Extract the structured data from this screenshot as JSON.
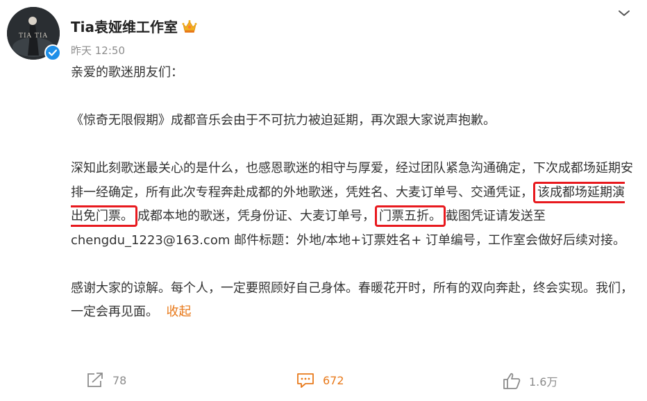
{
  "post": {
    "author": "Tia袁娅维工作室",
    "timestamp": "昨天 12:50",
    "avatar_text": "TIA TIA",
    "greeting": "亲爱的歌迷朋友们：",
    "para1": "《惊奇无限假期》成都音乐会由于不可抗力被迫延期，再次跟大家说声抱歉。",
    "para2_a": "深知此刻歌迷最关心的是什么，也感恩歌迷的相守与厚爱，经过团队紧急沟通确定，下次成都场延期安排一经确定，所有此次专程奔赴成都的外地歌迷，凭姓名、大麦订单号、交通凭证，",
    "para2_h1": "该成都场延期演出免门票。",
    "para2_b": "成都本地的歌迷，凭身份证、大麦订单号，",
    "para2_h2": "门票五折。",
    "para2_c": "截图凭证请发送至chengdu_1223@163.com 邮件标题：外地/本地+订票姓名+ 订单编号，工作室会做好后续对接。",
    "para3": "感谢大家的谅解。每个人，一定要照顾好自己身体。春暖花开时，所有的双向奔赴，终会实现。我们，一定会再见面。",
    "collapse_label": "收起"
  },
  "actions": {
    "share_count": "78",
    "comment_count": "672",
    "like_count": "1.6万"
  },
  "colors": {
    "highlight_border": "#e8191e",
    "accent": "#e8791a",
    "verified": "#1e8fe8"
  },
  "icons": [
    "verified-icon",
    "crown-icon",
    "more-chevron-icon",
    "share-icon",
    "comment-icon",
    "like-icon"
  ]
}
